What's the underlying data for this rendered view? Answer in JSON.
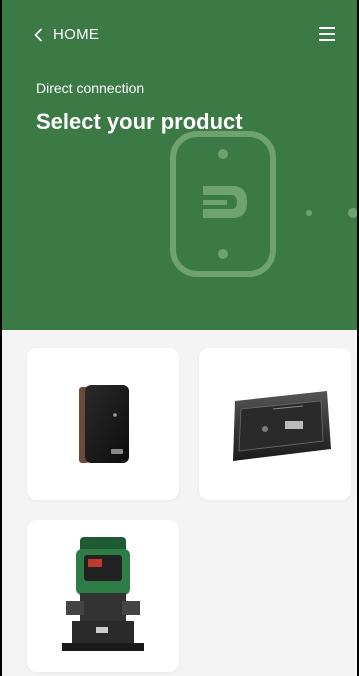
{
  "header": {
    "back_label": "HOME",
    "subtitle": "Direct connection",
    "title": "Select your product",
    "background_color": "#3c7a45",
    "back_icon": "chevron-left-icon",
    "menu_icon": "hamburger-menu-icon"
  },
  "hero": {
    "icon": "bluetooth-device-icon"
  },
  "products": [
    {
      "icon": "wall-mounted-controller-icon"
    },
    {
      "icon": "control-panel-device-icon"
    },
    {
      "icon": "booster-pump-icon"
    }
  ]
}
